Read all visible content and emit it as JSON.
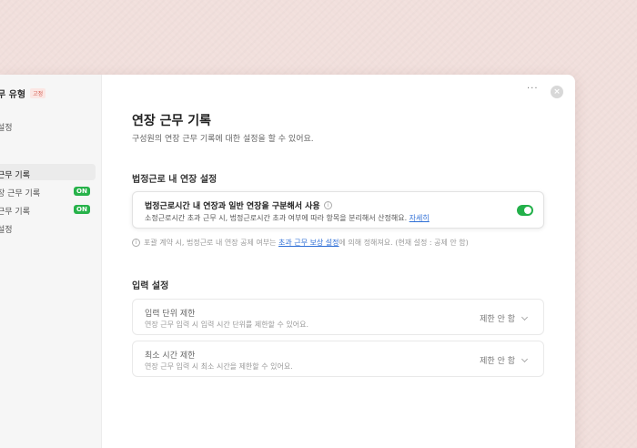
{
  "sidebar": {
    "title": "무 유형",
    "badge": "고정",
    "items": [
      {
        "label": "설정"
      },
      {
        "label": "근무 기록"
      },
      {
        "label": "장 근무 기록",
        "badge": "ON"
      },
      {
        "label": "근무 기록",
        "badge": "ON"
      },
      {
        "label": "설정"
      }
    ]
  },
  "header": {
    "more_label": "···",
    "close_label": "×"
  },
  "main": {
    "title": "연장 근무 기록",
    "description": "구성원의 연장 근무 기록에 대한 설정을 할 수 있어요.",
    "section1": {
      "title": "법정근로 내 연장 설정",
      "card": {
        "title": "법정근로시간 내 연장과 일반 연장을 구분해서 사용",
        "desc": "소정근로시간 초과 근무 시, 법정근로시간 초과 여부에 따라 항목을 분리해서 산정해요.",
        "link": "자세히",
        "toggle_on": true
      },
      "note_pre": "포괄 계약 시, 법정근로 내 연장 공제 여부는",
      "note_link": "초과 근무 보상 설정",
      "note_post": "에 의해 정해져요. (현재 설정 : 공제 안 함)"
    },
    "section2": {
      "title": "입력 설정",
      "rows": [
        {
          "title": "입력 단위 제한",
          "desc": "연장 근무 입력 시 입력 시간 단위를 제한할 수 있어요.",
          "value": "제한 안 함"
        },
        {
          "title": "최소 시간 제한",
          "desc": "연장 근무 입력 시 최소 시간을 제한할 수 있어요.",
          "value": "제한 안 함"
        }
      ]
    }
  },
  "colors": {
    "accent": "#23b04a",
    "link": "#2f6fd6",
    "badge": "#d35a4d"
  }
}
